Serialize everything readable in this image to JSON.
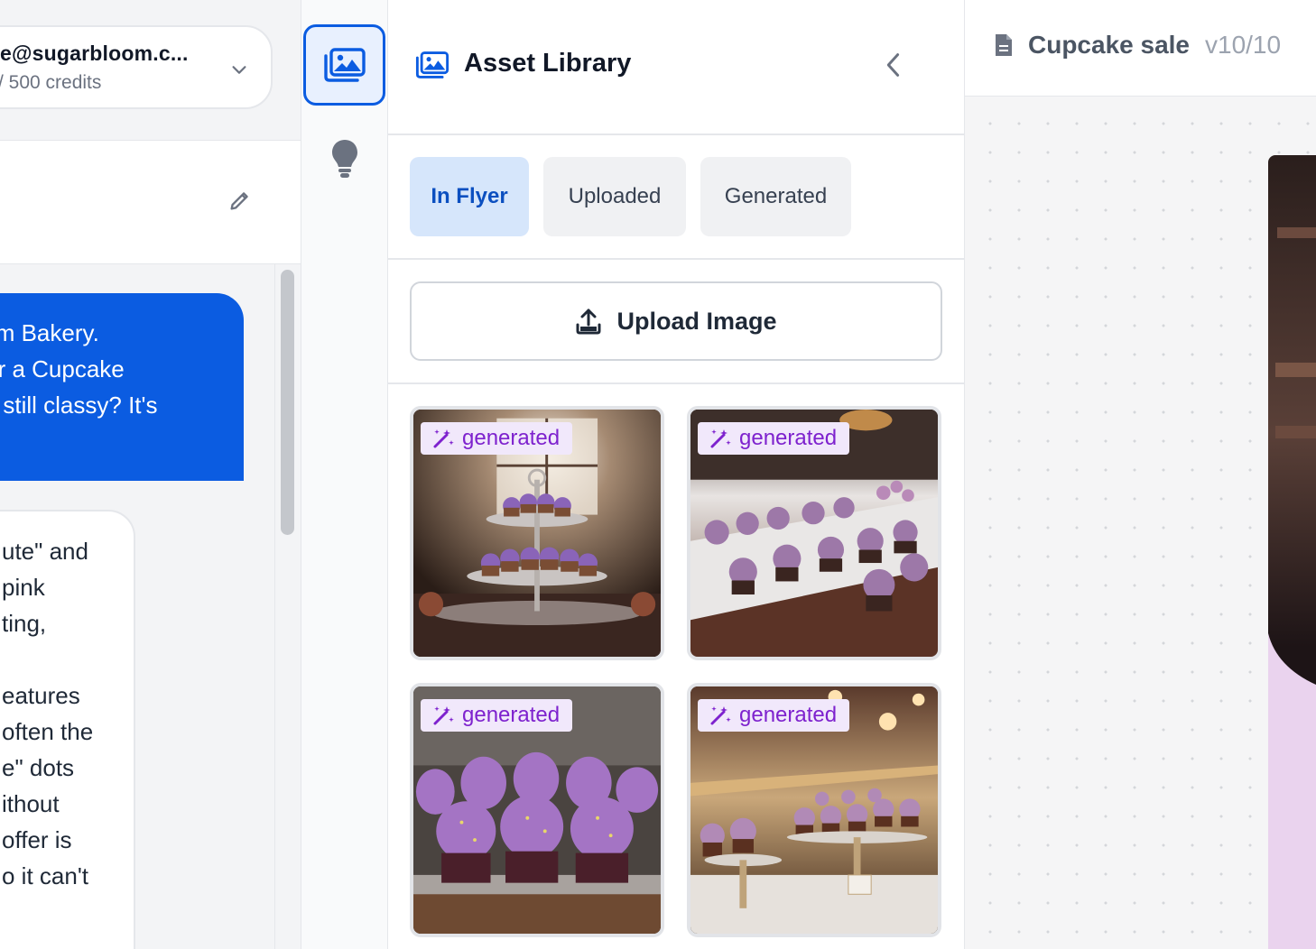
{
  "account": {
    "email": "e@sugarbloom.c...",
    "credits": "/ 500 credits"
  },
  "chat": {
    "user_message_lines": [
      "loom Bakery.",
      "r for a Cupcake",
      "out still classy? It's"
    ],
    "assistant_message_lines": [
      "ute\" and",
      "pink",
      "ting,",
      "",
      "eatures",
      "often the",
      "e\" dots",
      "ithout",
      "offer is",
      "o it can't"
    ]
  },
  "rail": {
    "items": [
      {
        "name": "asset-library",
        "icon": "images-icon",
        "active": true
      },
      {
        "name": "ideas",
        "icon": "lightbulb-icon",
        "active": false
      }
    ]
  },
  "asset_library": {
    "title": "Asset Library",
    "tabs": [
      {
        "label": "In Flyer",
        "active": true
      },
      {
        "label": "Uploaded",
        "active": false
      },
      {
        "label": "Generated",
        "active": false
      }
    ],
    "upload_label": "Upload Image",
    "assets": [
      {
        "badge": "generated",
        "subject": "cupcakes on tiered stand by window"
      },
      {
        "badge": "generated",
        "subject": "cupcakes on counter with orchids"
      },
      {
        "badge": "generated",
        "subject": "purple cupcakes on baking tray"
      },
      {
        "badge": "generated",
        "subject": "cupcakes in bakery display case"
      }
    ]
  },
  "editor": {
    "document_title": "Cupcake sale",
    "version": "v10/10"
  },
  "colors": {
    "primary": "#0b5ce1",
    "active_tab_bg": "#d6e6fb",
    "badge_bg": "#f1e8fb",
    "badge_text": "#7e22ce",
    "canvas_bg": "#f5f5f6"
  }
}
